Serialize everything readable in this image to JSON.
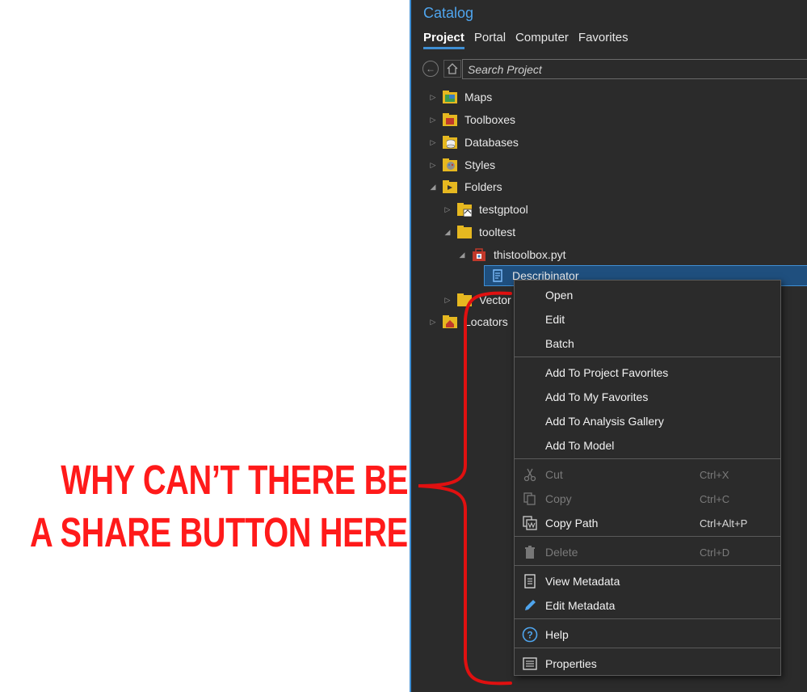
{
  "annotation": {
    "line1": "WHY CAN’T THERE BE",
    "line2": "A SHARE BUTTON HERE",
    "color": "#ff1a1a"
  },
  "catalog": {
    "title": "Catalog",
    "tabs": [
      {
        "label": "Project",
        "active": true
      },
      {
        "label": "Portal"
      },
      {
        "label": "Computer"
      },
      {
        "label": "Favorites"
      }
    ],
    "search_placeholder": "Search Project",
    "tree": [
      {
        "label": "Maps"
      },
      {
        "label": "Toolboxes"
      },
      {
        "label": "Databases"
      },
      {
        "label": "Styles"
      },
      {
        "label": "Folders"
      },
      {
        "label": "testgptool"
      },
      {
        "label": "tooltest"
      },
      {
        "label": "thistoolbox.pyt"
      },
      {
        "label": "Describinator"
      },
      {
        "label": "Vector"
      },
      {
        "label": "Locators"
      }
    ]
  },
  "context_menu": {
    "items": [
      {
        "label": "Open"
      },
      {
        "label": "Edit"
      },
      {
        "label": "Batch"
      },
      {
        "label": "Add To Project Favorites"
      },
      {
        "label": "Add To My Favorites"
      },
      {
        "label": "Add To Analysis Gallery"
      },
      {
        "label": "Add To Model"
      },
      {
        "label": "Cut",
        "shortcut": "Ctrl+X",
        "disabled": true
      },
      {
        "label": "Copy",
        "shortcut": "Ctrl+C",
        "disabled": true
      },
      {
        "label": "Copy Path",
        "shortcut": "Ctrl+Alt+P"
      },
      {
        "label": "Delete",
        "shortcut": "Ctrl+D",
        "disabled": true
      },
      {
        "label": "View Metadata"
      },
      {
        "label": "Edit Metadata"
      },
      {
        "label": "Help"
      },
      {
        "label": "Properties"
      }
    ]
  },
  "colors": {
    "accent": "#3f8fd4",
    "panel_bg": "#2b2b2b",
    "selection": "#1f4f7e",
    "folder": "#e6b820"
  }
}
